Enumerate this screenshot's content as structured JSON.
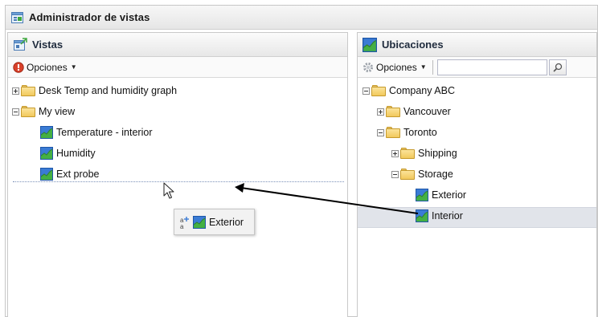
{
  "window": {
    "title": "Administrador de vistas"
  },
  "left_panel": {
    "title": "Vistas",
    "options_label": "Opciones",
    "tree": [
      {
        "label": "Desk Temp and humidity graph",
        "type": "folder",
        "expander": "plus"
      },
      {
        "label": "My view",
        "type": "folder-open",
        "expander": "minus"
      },
      {
        "label": "Temperature - interior",
        "type": "view"
      },
      {
        "label": "Humidity",
        "type": "view"
      },
      {
        "label": "Ext probe",
        "type": "view"
      }
    ]
  },
  "drag_proxy": {
    "label": "Exterior"
  },
  "right_panel": {
    "title": "Ubicaciones",
    "options_label": "Opciones",
    "search": {
      "value": "",
      "placeholder": ""
    },
    "tree": [
      {
        "label": "Company ABC",
        "type": "folder-open",
        "expander": "minus"
      },
      {
        "label": "Vancouver",
        "type": "folder",
        "expander": "plus"
      },
      {
        "label": "Toronto",
        "type": "folder-open",
        "expander": "minus"
      },
      {
        "label": "Shipping",
        "type": "folder",
        "expander": "plus"
      },
      {
        "label": "Storage",
        "type": "folder-open",
        "expander": "minus"
      },
      {
        "label": "Exterior",
        "type": "location",
        "selected": true
      },
      {
        "label": "Interior",
        "type": "location"
      }
    ]
  },
  "icons": {
    "window": "views-manager-icon",
    "left_header": "views-icon",
    "right_header": "location-chart-icon",
    "left_options": "red-options-icon",
    "right_options": "gear-icon",
    "search": "magnifier-icon",
    "drag_copy": "copy-add-icon",
    "cursor": "mouse-pointer-icon"
  },
  "colors": {
    "panel_title": "#1f2b3d",
    "selection": "#e1e4ea",
    "folder": "#f2c95d",
    "chart_blue": "#3a7bd5",
    "chart_green": "#3fa83f"
  }
}
